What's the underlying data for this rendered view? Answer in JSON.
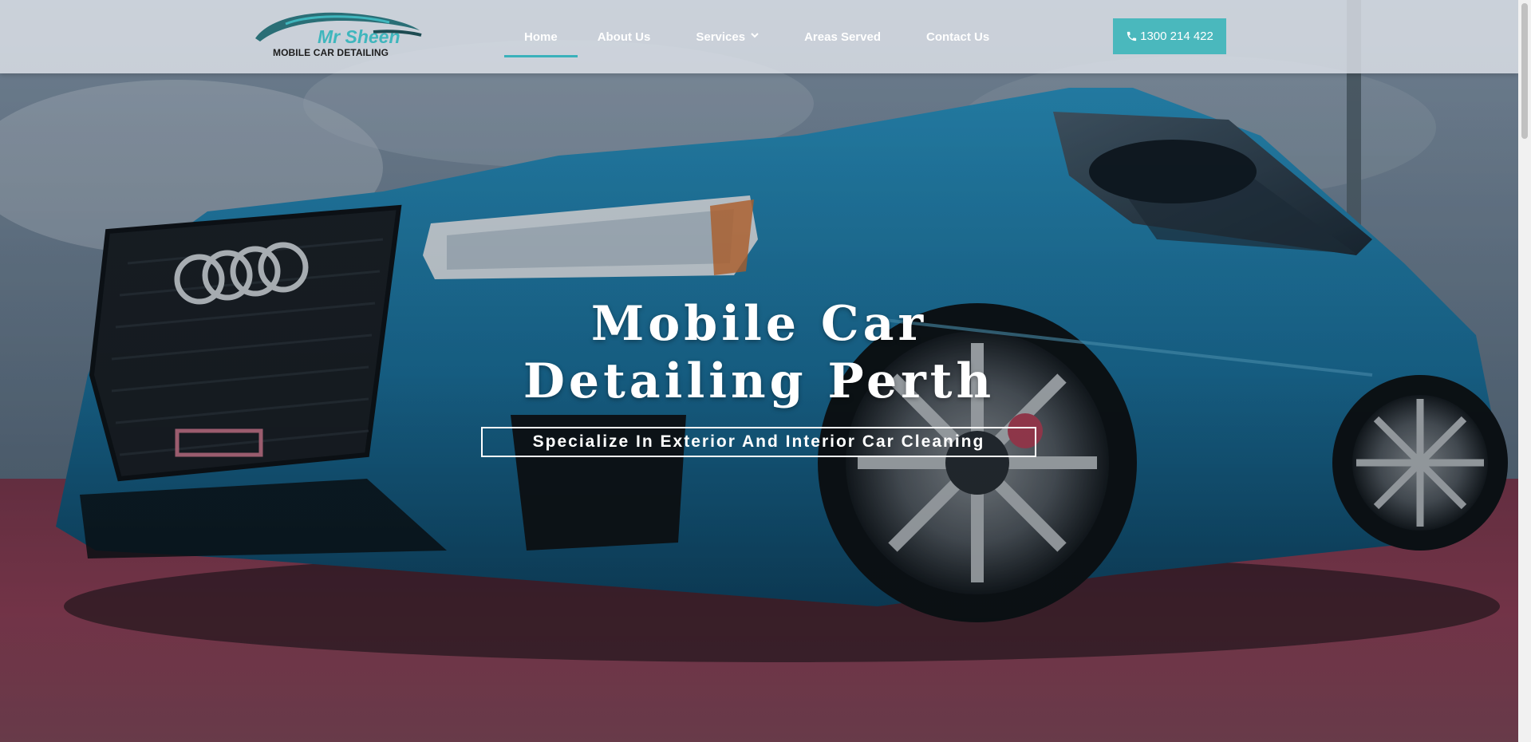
{
  "logo": {
    "name": "Mr Sheen",
    "tagline": "MOBILE CAR DETAILING"
  },
  "nav": {
    "items": [
      {
        "label": "Home",
        "active": true
      },
      {
        "label": "About Us",
        "active": false
      },
      {
        "label": "Services",
        "active": false,
        "has_dropdown": true
      },
      {
        "label": "Areas Served",
        "active": false
      },
      {
        "label": "Contact Us",
        "active": false
      }
    ]
  },
  "phone": {
    "label": "1300 214 422",
    "icon": "phone-icon"
  },
  "hero": {
    "title_line1": "Mobile Car",
    "title_line2": "Detailing Perth",
    "tagline": "Specialize In Exterior And Interior Car Cleaning",
    "image": "blue-audi-sedan-photo"
  },
  "colors": {
    "accent": "#4ab8bd",
    "active_underline": "#3ab1bb",
    "car_blue": "#1f7fb0",
    "ground_red": "#a9405a"
  }
}
